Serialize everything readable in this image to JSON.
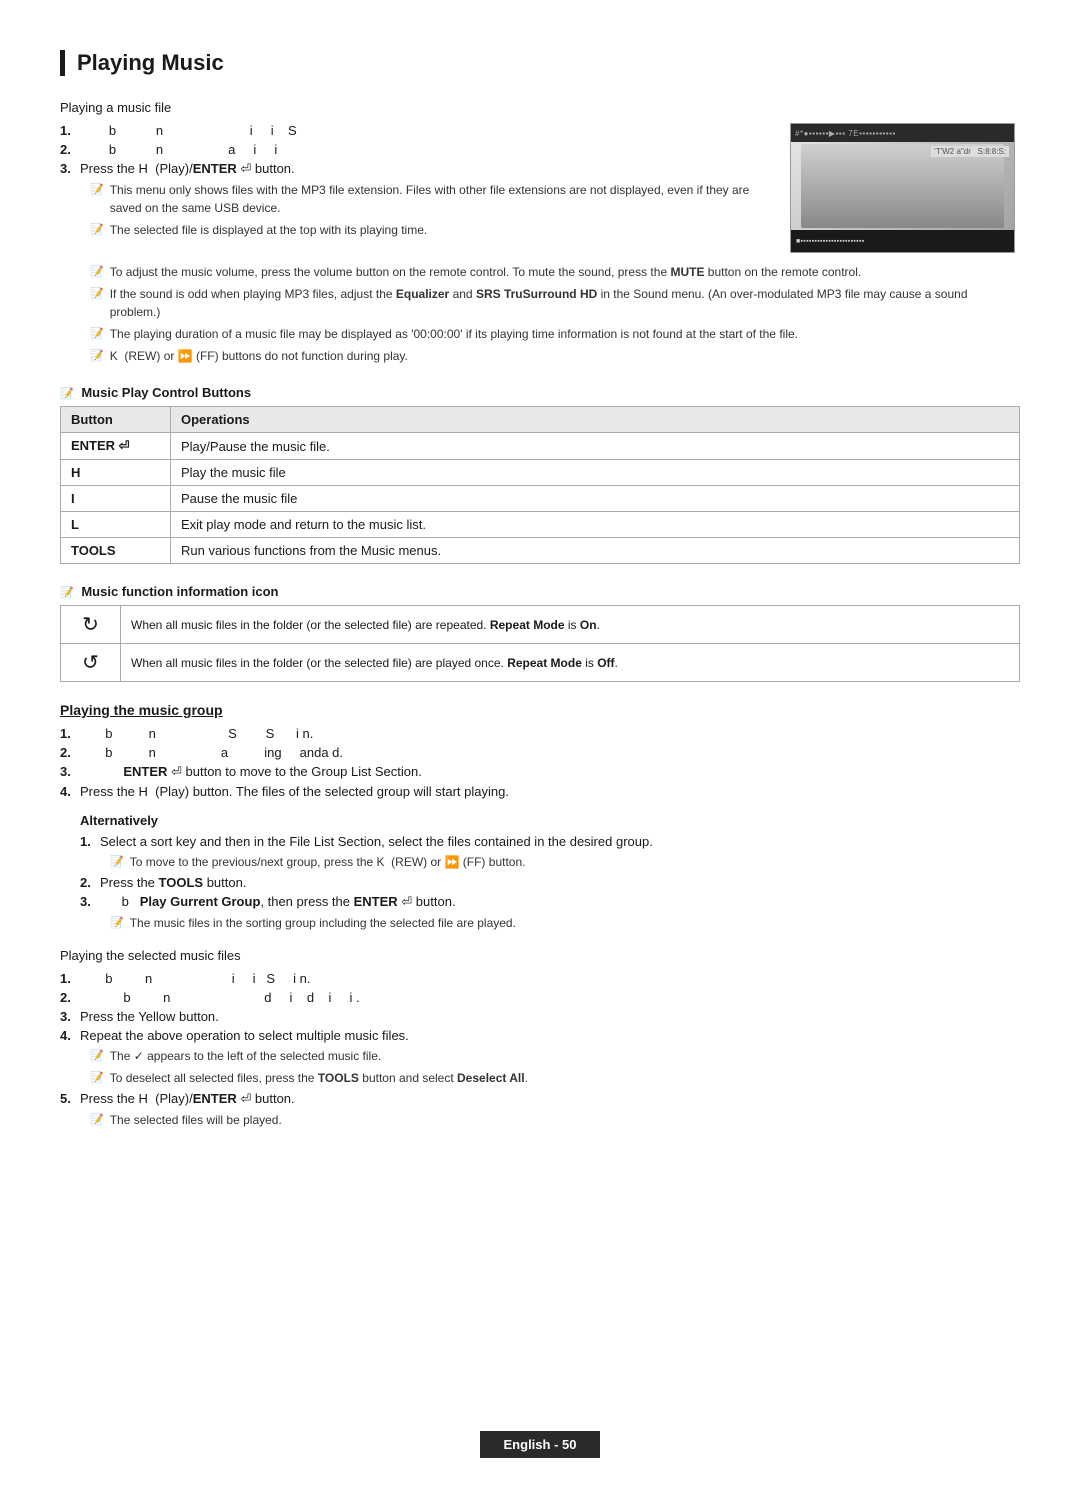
{
  "page": {
    "title": "Playing Music",
    "footer": "English - 50"
  },
  "playing_a_music_file": {
    "label": "Playing a music file",
    "steps": [
      {
        "num": "1.",
        "text": "b n i i S"
      },
      {
        "num": "2.",
        "text": "b n a i i"
      },
      {
        "num": "3.",
        "text": "Press the H  (Play)/ENTER  button."
      }
    ],
    "notes": [
      "This menu only shows files with the MP3 file extension. Files with other file extensions are not displayed, even if they are saved on the same USB device.",
      "The selected file is displayed at the top with its playing time.",
      "To adjust the music volume, press the volume button on the remote control. To mute the sound, press the MUTE button on the remote control.",
      "If the sound is odd when playing MP3 files, adjust the Equalizer and SRS TruSurround HD in the Sound menu. (An over-modulated MP3 file may cause a sound problem.)",
      "The playing duration of a music file may be displayed as '00:00:00' if its playing time information is not found at the start of the file.",
      "K  (REW) or  (FF) buttons do not function during play."
    ]
  },
  "music_play_control_buttons": {
    "header": "Music Play Control Buttons",
    "columns": [
      "Button",
      "Operations"
    ],
    "rows": [
      {
        "button": "ENTER",
        "operation": "Play/Pause the music file."
      },
      {
        "button": "H",
        "operation": "Play the music file"
      },
      {
        "button": "I",
        "operation": "Pause the music file"
      },
      {
        "button": "L",
        "operation": "Exit play mode and return to the music list."
      },
      {
        "button": "TOOLS",
        "operation": "Run various functions from the Music menus."
      }
    ]
  },
  "music_function_icon": {
    "header": "Music function information icon",
    "rows": [
      {
        "icon": "↻",
        "text": "When all music files in the folder (or the selected file) are repeated. Repeat Mode is On."
      },
      {
        "icon": "↺",
        "text": "When all music files in the folder (or the selected file) are played once. Repeat Mode is Off."
      }
    ]
  },
  "playing_the_music_group": {
    "label": "Playing the music group",
    "steps": [
      {
        "num": "1.",
        "text": "b n S S i n."
      },
      {
        "num": "2.",
        "text": "b n a ing anda d."
      },
      {
        "num": "3.",
        "text": "ENTER  button to move to the Group List Section."
      },
      {
        "num": "4.",
        "text": "Press the H  (Play) button. The files of the selected group will start playing."
      }
    ],
    "alternatively": {
      "label": "Alternatively",
      "steps": [
        {
          "num": "1.",
          "text": "Select a sort key and then in the File List Section, select the files contained in the desired group."
        },
        {
          "num": "",
          "note": "To move to the previous/next group, press the  K  (REW) or  (FF) button."
        },
        {
          "num": "2.",
          "text": "Press the TOOLS button."
        },
        {
          "num": "3.",
          "text": "b  Play Gurrent Group, then press the ENTER  button."
        },
        {
          "num": "",
          "note": "The music files in the sorting group including the selected file are played."
        }
      ]
    }
  },
  "playing_the_selected_music_files": {
    "label": "Playing the selected music files",
    "steps": [
      {
        "num": "1.",
        "text": "b n i i S i n."
      },
      {
        "num": "2.",
        "text": "b n d i d i i ."
      },
      {
        "num": "3.",
        "text": "Press the Yellow button."
      },
      {
        "num": "4.",
        "text": "Repeat the above operation to select multiple music files."
      },
      {
        "num": "5.",
        "text": "Press the H  (Play)/ENTER  button."
      }
    ],
    "notes_4": [
      "The ✓ appears to the left of the selected music file.",
      "To deselect all selected files, press the TOOLS button and select Deselect All."
    ],
    "notes_5": [
      "The selected files will be played."
    ]
  }
}
